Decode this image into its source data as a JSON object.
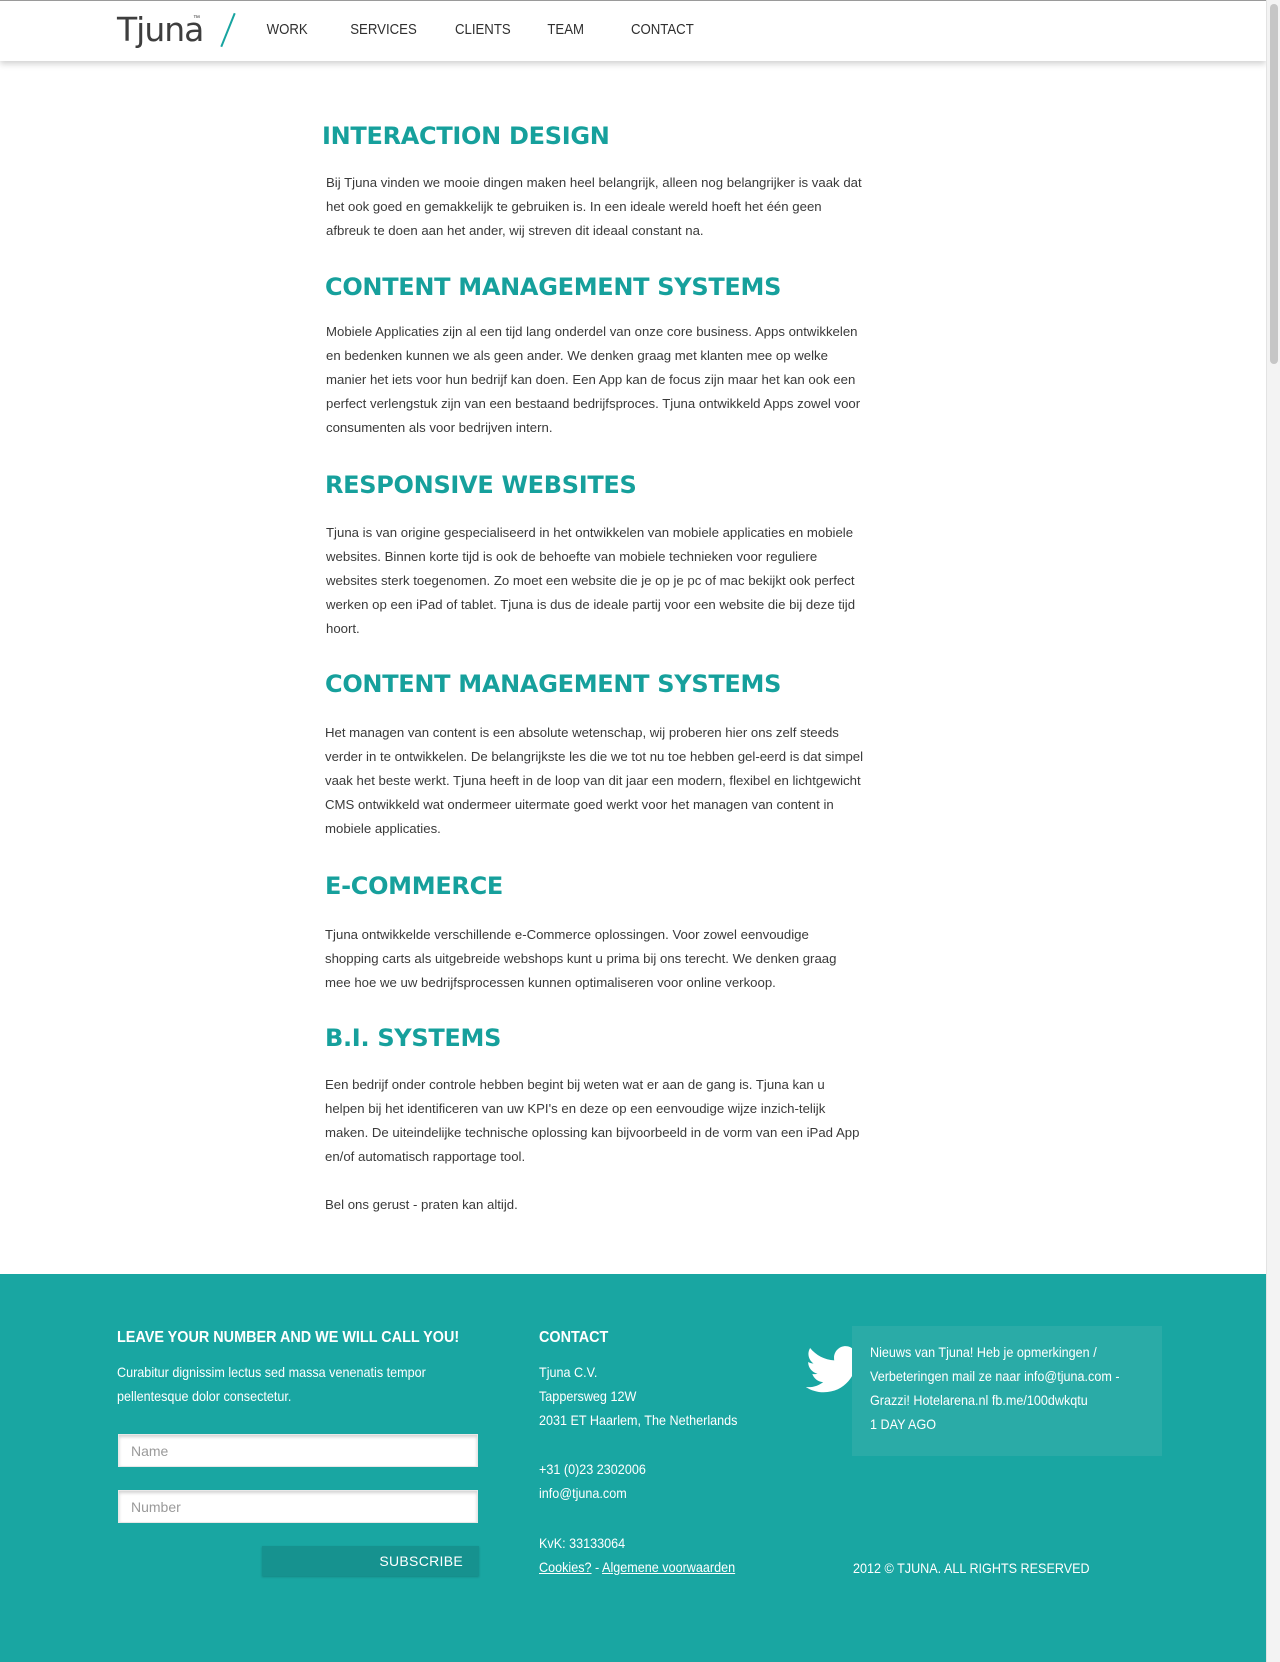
{
  "header": {
    "logo": "Tjuna",
    "logo_tm": "™",
    "nav": [
      "WORK",
      "SERVICES",
      "CLIENTS",
      "TEAM",
      "CONTACT"
    ]
  },
  "sections": [
    {
      "title": "INTERACTION DESIGN",
      "text": "Bij Tjuna vinden we mooie dingen maken heel belangrijk, alleen nog belangrijker is vaak dat het ook goed en gemakkelijk te gebruiken is. In een ideale wereld hoeft het één geen afbreuk te doen aan het ander, wij streven dit ideaal constant na."
    },
    {
      "title": "CONTENT MANAGEMENT SYSTEMS",
      "text": "Mobiele Applicaties zijn al een tijd lang onderdel van onze core business. Apps ontwikkelen en bedenken kunnen we als geen ander. We denken graag met klanten mee op welke manier het iets voor hun bedrijf kan doen. Een App kan de focus zijn maar het kan ook een perfect verlengstuk zijn van een bestaand bedrijfsproces. Tjuna ontwikkeld Apps zowel voor consumenten als voor bedrijven intern."
    },
    {
      "title": "RESPONSIVE WEBSITES",
      "text": "Tjuna is van origine gespecialiseerd in het ontwikkelen van mobiele applicaties en mobiele websites. Binnen korte tijd is ook de behoefte van mobiele technieken voor reguliere websites sterk toegenomen. Zo moet een website die je op je pc of mac bekijkt ook perfect werken op een iPad of tablet. Tjuna is dus de ideale partij voor een website die bij deze tijd hoort."
    },
    {
      "title": "CONTENT MANAGEMENT SYSTEMS",
      "text": "Het managen van content is een absolute wetenschap, wij proberen hier ons zelf steeds verder in te ontwikkelen. De belangrijkste les die we tot nu toe hebben gel-eerd is dat simpel vaak het beste werkt. Tjuna heeft in de loop van dit jaar een modern, flexibel en lichtgewicht CMS ontwikkeld wat ondermeer uitermate goed werkt voor het managen van content in mobiele applicaties."
    },
    {
      "title": "E-COMMERCE",
      "text": "Tjuna ontwikkelde verschillende e-Commerce oplossingen. Voor zowel eenvoudige shopping carts als uitgebreide webshops kunt u prima bij ons terecht. We denken graag mee hoe we uw bedrijfsprocessen kunnen optimaliseren voor online verkoop."
    },
    {
      "title": "B.I. SYSTEMS",
      "text": "Een bedrijf onder controle hebben begint bij weten wat er aan de gang is. Tjuna kan u helpen bij het identificeren van uw KPI's en deze op een eenvoudige wijze inzich-telijk maken. De uiteindelijke technische oplossing kan bijvoorbeeld in de vorm van een iPad App en/of automatisch rapportage tool."
    }
  ],
  "closing": "Bel ons gerust - praten kan altijd.",
  "footer": {
    "callback": {
      "title": "LEAVE YOUR NUMBER AND WE WILL CALL YOU!",
      "text_lines": [
        "Curabitur dignissim lectus sed massa venenatis tempor",
        "pellentesque dolor consectetur."
      ],
      "name_placeholder": "Name",
      "number_placeholder": "Number",
      "subscribe_label": "SUBSCRIBE"
    },
    "contact": {
      "title": "CONTACT",
      "address": [
        "Tjuna C.V.",
        "Tappersweg 12W",
        "2031 ET Haarlem, The Netherlands"
      ],
      "phone": "+31 (0)23 2302006",
      "email": "info@tjuna.com",
      "kvk": "KvK: 33133064",
      "cookies_link": "Cookies?",
      "separator": " - ",
      "terms_link": "Algemene voorwaarden"
    },
    "twitter": {
      "icon": "twitter-bird-icon",
      "tweet_lines": [
        "Nieuws van Tjuna! Heb je opmerkingen /",
        "Verbeteringen mail ze naar info@tjuna.com -",
        "Grazzi! Hotelarena.nl fb.me/100dwkqtu"
      ],
      "time": "1 DAY AGO"
    },
    "copyright": "2012 © TJUNA. ALL RIGHTS RESERVED"
  },
  "colors": {
    "accent": "#16a09c",
    "footer_bg": "#19a6a2",
    "tweet_bg": "#2aaba7",
    "subscribe_bg": "#16928f"
  }
}
